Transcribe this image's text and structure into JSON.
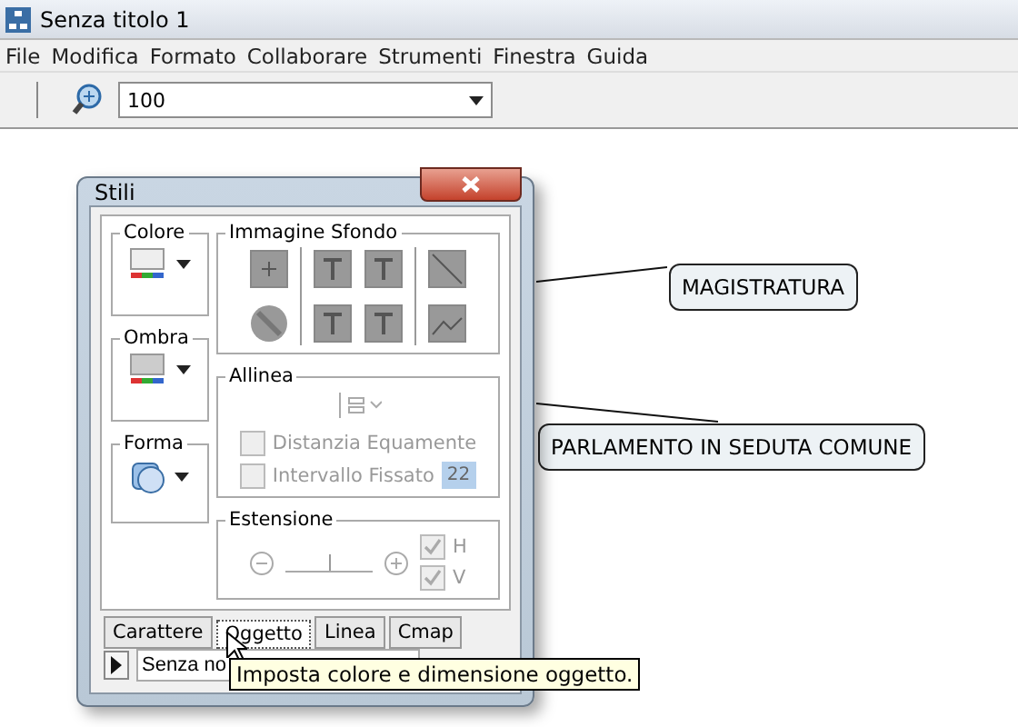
{
  "window": {
    "title": "Senza titolo 1"
  },
  "menu": [
    "File",
    "Modifica",
    "Formato",
    "Collaborare",
    "Strumenti",
    "Finestra",
    "Guida"
  ],
  "toolbar": {
    "zoom": "100"
  },
  "dialog": {
    "title": "Stili",
    "colore": {
      "label": "Colore"
    },
    "ombra": {
      "label": "Ombra"
    },
    "forma": {
      "label": "Forma"
    },
    "immagine": {
      "label": "Immagine Sfondo"
    },
    "allinea": {
      "label": "Allinea",
      "options": [
        {
          "label": "Distanzia Equamente",
          "checked": false,
          "disabled": true
        },
        {
          "label": "Intervallo Fissato",
          "checked": false,
          "disabled": true
        }
      ],
      "spacing": "22"
    },
    "estensione": {
      "label": "Estensione",
      "level": 0.5,
      "options": [
        {
          "label": "H",
          "checked": true,
          "disabled": true
        },
        {
          "label": "V",
          "checked": true,
          "disabled": true
        }
      ]
    },
    "tabs": [
      {
        "label": "Carattere",
        "selected": false
      },
      {
        "label": "Oggetto",
        "selected": true
      },
      {
        "label": "Linea",
        "selected": false
      },
      {
        "label": "Cmap",
        "selected": false
      }
    ],
    "style_field": "Senza no",
    "tooltip": "Imposta colore e dimensione oggetto."
  },
  "nodes": [
    {
      "label": "MAGISTRATURA"
    },
    {
      "label": "PARLAMENTO IN SEDUTA COMUNE"
    }
  ]
}
